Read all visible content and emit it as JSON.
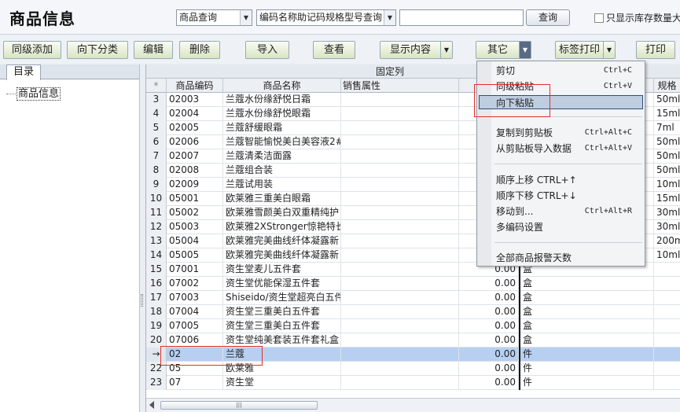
{
  "app": {
    "title": "商品信息"
  },
  "search": {
    "mode": "商品查询",
    "field": "编码名称助记码规格型号查询",
    "value": "",
    "query_label": "查询",
    "stock_only_label": "只显示库存数量大"
  },
  "toolbar": {
    "add_same_level": "同级添加",
    "add_sub_category": "向下分类",
    "edit": "编辑",
    "delete": "删除",
    "import": "导入",
    "view": "查看",
    "display_content": "显示内容",
    "other": "其它",
    "label_print": "标签打印",
    "print": "打印"
  },
  "left_panel": {
    "tab": "目录",
    "tree_root": "商品信息"
  },
  "grid": {
    "group_header": "固定列",
    "columns": {
      "marker": "*",
      "code": "商品编码",
      "name": "商品名称",
      "sales_attr": "销售属性",
      "spec": "规格"
    },
    "rows": [
      {
        "n": "3",
        "code": "02003",
        "name": "兰蔻水份缘舒悦日霜",
        "spec": "50ml"
      },
      {
        "n": "4",
        "code": "02004",
        "name": "兰蔻水份缘舒悦眼霜",
        "spec": "15ml"
      },
      {
        "n": "5",
        "code": "02005",
        "name": "兰蔻舒缓眼霜",
        "spec": "7ml"
      },
      {
        "n": "6",
        "code": "02006",
        "name": "兰蔻智能愉悦美白美容液2#",
        "spec": "50ml"
      },
      {
        "n": "7",
        "code": "02007",
        "name": "兰蔻清柔洁面露",
        "spec": "50ml"
      },
      {
        "n": "8",
        "code": "02008",
        "name": "兰蔻组合装",
        "spec": "50ml"
      },
      {
        "n": "9",
        "code": "02009",
        "name": "兰蔻试用装",
        "spec": "10ml"
      },
      {
        "n": "10",
        "code": "05001",
        "name": "欧莱雅三重美白眼霜",
        "spec": "15ml"
      },
      {
        "n": "11",
        "code": "05002",
        "name": "欧莱雅雪颜美白双重精纯护",
        "spec": "30ml"
      },
      {
        "n": "12",
        "code": "05003",
        "name": "欧莱雅2XStronger惊艳特长",
        "spec": "30ml"
      },
      {
        "n": "13",
        "code": "05004",
        "name": "欧莱雅完美曲线纤体凝露新",
        "spec": "200ml"
      },
      {
        "n": "14",
        "code": "05005",
        "name": "欧莱雅完美曲线纤体凝露新",
        "spec": "10ml"
      },
      {
        "n": "15",
        "code": "07001",
        "name": "资生堂麦儿五件套",
        "price": "0.00",
        "unit": "盒"
      },
      {
        "n": "16",
        "code": "07002",
        "name": "资生堂优能保湿五件套",
        "price": "0.00",
        "unit": "盒"
      },
      {
        "n": "17",
        "code": "07003",
        "name": "Shiseido/资生堂超亮白五件",
        "price": "0.00",
        "unit": "盒"
      },
      {
        "n": "18",
        "code": "07004",
        "name": "资生堂三重美白五件套",
        "price": "0.00",
        "unit": "盒"
      },
      {
        "n": "19",
        "code": "07005",
        "name": "资生堂三重美白五件套",
        "price": "0.00",
        "unit": "盒"
      },
      {
        "n": "20",
        "code": "07006",
        "name": "资生堂纯美套装五件套礼盒",
        "price": "0.00",
        "unit": "盒"
      },
      {
        "n": "→",
        "code": "02",
        "name": "兰蔻",
        "price": "0.00",
        "unit": "件"
      },
      {
        "n": "22",
        "code": "05",
        "name": "欧莱雅",
        "price": "0.00",
        "unit": "件"
      },
      {
        "n": "23",
        "code": "07",
        "name": "资生堂",
        "price": "0.00",
        "unit": "件"
      }
    ]
  },
  "context_menu": {
    "cut": "剪切",
    "cut_key": "Ctrl+C",
    "paste_same_level": "同级粘贴",
    "paste_same_level_key": "Ctrl+V",
    "paste_down": "向下粘贴",
    "copy_clipboard": "复制到剪贴板",
    "copy_clipboard_key": "Ctrl+Alt+C",
    "import_clipboard": "从剪贴板导入数据",
    "import_clipboard_key": "Ctrl+Alt+V",
    "move_up": "顺序上移 CTRL+↑",
    "move_down": "顺序下移 CTRL+↓",
    "move_to": "移动到...",
    "move_to_key": "Ctrl+Alt+R",
    "multi_code": "多编码设置",
    "stock_alert": "全部商品报警天数"
  },
  "colors": {
    "highlight": "#bfcde0",
    "annotation_red": "#e0302c",
    "selected_row": "#b7cff1"
  }
}
